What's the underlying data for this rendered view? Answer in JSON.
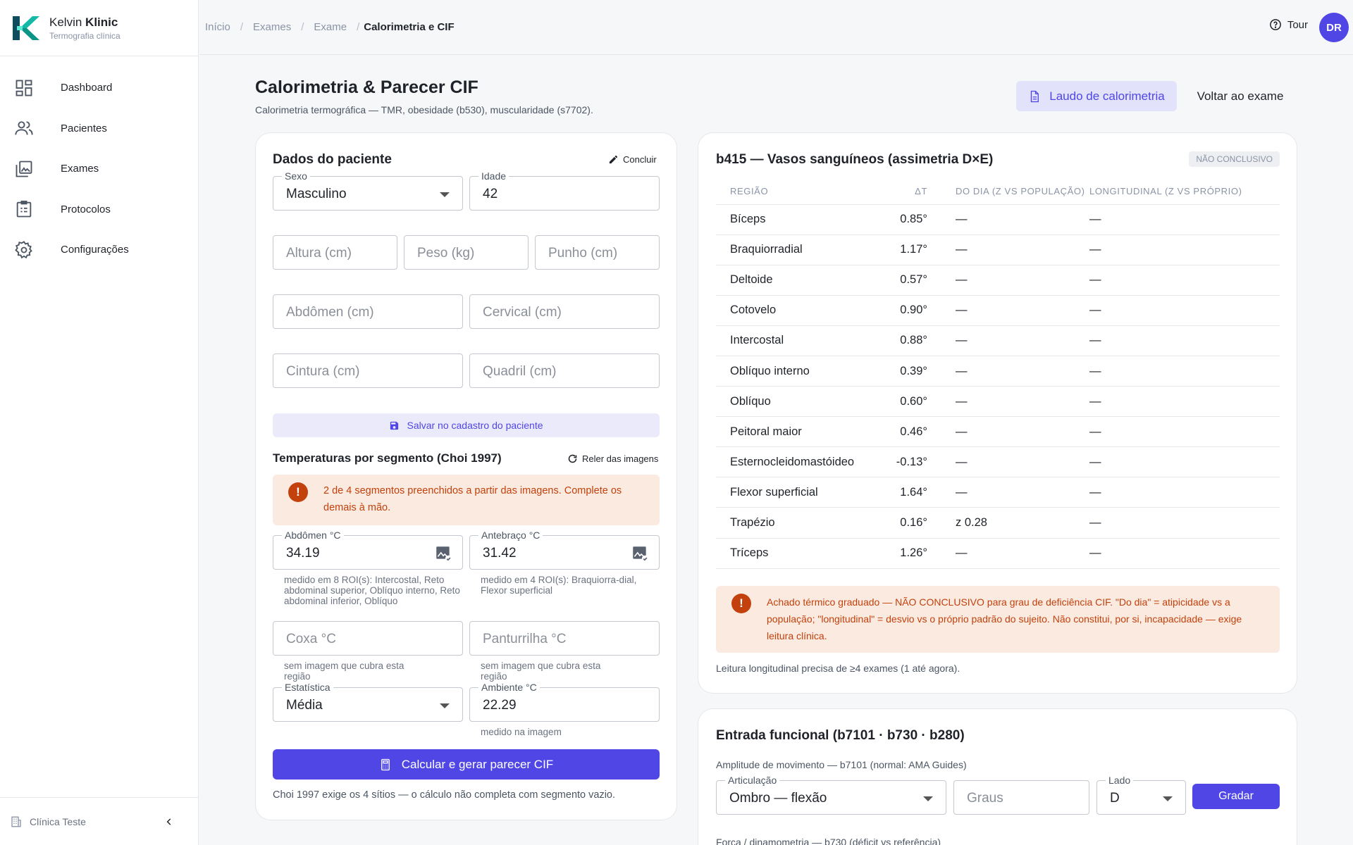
{
  "brand": {
    "name_first": "Kelvin",
    "name_bold": "Klinic",
    "subtitle": "Termografia clínica"
  },
  "nav": [
    {
      "label": "Dashboard",
      "icon": "dashboard-icon"
    },
    {
      "label": "Pacientes",
      "icon": "patients-icon"
    },
    {
      "label": "Exames",
      "icon": "exams-icon"
    },
    {
      "label": "Protocolos",
      "icon": "protocols-icon"
    },
    {
      "label": "Configurações",
      "icon": "gear-icon"
    }
  ],
  "sidebar_footer": {
    "label": "Clínica Teste"
  },
  "breadcrumb": [
    "Início",
    "Exames",
    "Exame",
    "Calorimetria e CIF"
  ],
  "topbar": {
    "tour_label": "Tour",
    "avatar": "DR"
  },
  "page": {
    "title": "Calorimetria & Parecer CIF",
    "subtitle": "Calorimetria termográfica — TMR, obesidade (b530), muscularidade (s7702).",
    "report_button": "Laudo de calorimetria",
    "back_button": "Voltar ao exame"
  },
  "patient": {
    "title": "Dados do paciente",
    "conclude": "Concluir",
    "sex": {
      "label": "Sexo",
      "value": "Masculino"
    },
    "age": {
      "label": "Idade",
      "value": "42"
    },
    "height": {
      "placeholder": "Altura (cm)"
    },
    "weight": {
      "placeholder": "Peso (kg)"
    },
    "wrist": {
      "placeholder": "Punho (cm)"
    },
    "abdomen": {
      "placeholder": "Abdômen (cm)"
    },
    "cervical": {
      "placeholder": "Cervical (cm)"
    },
    "waist": {
      "placeholder": "Cintura (cm)"
    },
    "hip": {
      "placeholder": "Quadril (cm)"
    },
    "save_button": "Salvar no cadastro do paciente"
  },
  "segments": {
    "title": "Temperaturas por segmento (Choi 1997)",
    "reread": "Reler das imagens",
    "alert": "2 de 4 segmentos preenchidos a partir das imagens. Complete os demais à mão.",
    "abdomen": {
      "label": "Abdômen °C",
      "value": "34.19",
      "helper": "medido em 8 ROI(s): Intercostal, Reto abdominal superior, Oblíquo interno, Reto abdominal inferior, Oblíquo"
    },
    "forearm": {
      "label": "Antebraço °C",
      "value": "31.42",
      "helper": "medido em 4 ROI(s): Braquiorra-dial, Flexor superficial"
    },
    "thigh": {
      "placeholder": "Coxa °C",
      "helper": "sem imagem que cubra esta região"
    },
    "calf": {
      "placeholder": "Panturrilha °C",
      "helper": "sem imagem que cubra esta região"
    },
    "statistic": {
      "label": "Estatística",
      "value": "Média"
    },
    "ambient": {
      "label": "Ambiente °C",
      "value": "22.29",
      "helper": "medido na imagem"
    },
    "calc_button": "Calcular e gerar parecer CIF",
    "footnote": "Choi 1997 exige os 4 sítios — o cálculo não completa com segmento vazio."
  },
  "vessels": {
    "title": "b415 — Vasos sanguíneos (assimetria D×E)",
    "badge": "NÃO CONCLUSIVO",
    "columns": [
      "REGIÃO",
      "ΔT",
      "DO DIA (Z VS POPULAÇÃO)",
      "LONGITUDINAL (Z VS PRÓPRIO)"
    ],
    "rows": [
      {
        "region": "Bíceps",
        "dt": "0.85°",
        "day": "—",
        "long": "—"
      },
      {
        "region": "Braquiorradial",
        "dt": "1.17°",
        "day": "—",
        "long": "—"
      },
      {
        "region": "Deltoide",
        "dt": "0.57°",
        "day": "—",
        "long": "—"
      },
      {
        "region": "Cotovelo",
        "dt": "0.90°",
        "day": "—",
        "long": "—"
      },
      {
        "region": "Intercostal",
        "dt": "0.88°",
        "day": "—",
        "long": "—"
      },
      {
        "region": "Oblíquo interno",
        "dt": "0.39°",
        "day": "—",
        "long": "—"
      },
      {
        "region": "Oblíquo",
        "dt": "0.60°",
        "day": "—",
        "long": "—"
      },
      {
        "region": "Peitoral maior",
        "dt": "0.46°",
        "day": "—",
        "long": "—"
      },
      {
        "region": "Esternocleidomastóideo",
        "dt": "-0.13°",
        "day": "—",
        "long": "—"
      },
      {
        "region": "Flexor superficial",
        "dt": "1.64°",
        "day": "—",
        "long": "—"
      },
      {
        "region": "Trapézio",
        "dt": "0.16°",
        "day": "z 0.28",
        "long": "—"
      },
      {
        "region": "Tríceps",
        "dt": "1.26°",
        "day": "—",
        "long": "—"
      }
    ],
    "alert": "Achado térmico graduado — NÃO CONCLUSIVO para grau de deficiência CIF. \"Do dia\" = atipicidade vs a população; \"longitudinal\" = desvio vs o próprio padrão do sujeito. Não constitui, por si, incapacidade — exige leitura clínica.",
    "note": "Leitura longitudinal precisa de ≥4 exames (1 até agora)."
  },
  "functional": {
    "title": "Entrada funcional (b7101 · b730 · b280)",
    "rom_label": "Amplitude de movimento — b7101 (normal: AMA Guides)",
    "joint": {
      "label": "Articulação",
      "value": "Ombro — flexão"
    },
    "degrees": {
      "placeholder": "Graus"
    },
    "side": {
      "label": "Lado",
      "value": "D"
    },
    "grade_button": "Gradar",
    "strength_label": "Força / dinamometria — b730 (déficit vs referência)"
  },
  "colors": {
    "accent": "#4f46e5",
    "accent_soft": "#e3e2fb",
    "warning": "#c2410c",
    "warning_bg": "#fbeae0",
    "brand_teal": "#0d9488"
  }
}
